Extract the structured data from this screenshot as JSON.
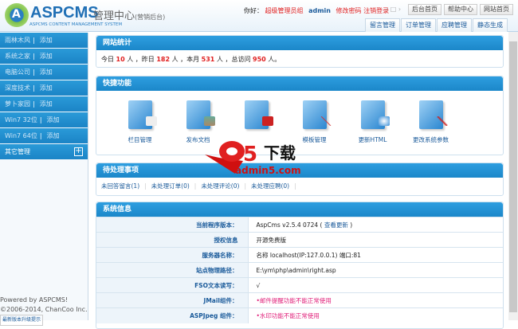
{
  "header": {
    "brand": "ASPCMS",
    "brand_cn": "管理中心",
    "brand_note": "(营销后台)",
    "brand_sub": "ASPCMS CONTENT MANAGEMENT SYSTEM",
    "greeting": "你好：",
    "role": "超级管理员组",
    "user": "admin",
    "change_pwd": "修改密码",
    "logout": "注销登录",
    "arrows": "‹ □ ›",
    "buttons": [
      "后台首页",
      "帮助中心",
      "网站首页"
    ],
    "tabs": [
      "留言管理",
      "订单管理",
      "应聘管理",
      "静态生成"
    ]
  },
  "sidebar": {
    "items": [
      {
        "label": "雨林木风",
        "add": "添加"
      },
      {
        "label": "系统之家",
        "add": "添加"
      },
      {
        "label": "电脑公司",
        "add": "添加"
      },
      {
        "label": "深度技术",
        "add": "添加"
      },
      {
        "label": "萝卜家园",
        "add": "添加"
      },
      {
        "label": "Win7 32位",
        "add": "添加"
      },
      {
        "label": "Win7 64位",
        "add": "添加"
      }
    ],
    "other": "其它管理",
    "other_icon": "plus-icon",
    "footer": [
      "Powered by ASPCMS!",
      "©2006-2014, ChanCoo Inc."
    ],
    "footer_link": "最新版本升级提示"
  },
  "stats": {
    "title": "网站统计",
    "today_label": "今日",
    "today": "10",
    "yesterday_label": "，昨日",
    "yesterday": "182",
    "month_label": "，本月",
    "month": "531",
    "total_label": "，总访问",
    "total": "950",
    "unit": "人",
    "end": "。"
  },
  "quick": {
    "title": "快捷功能",
    "items": [
      {
        "label": "栏目管理"
      },
      {
        "label": "发布文档"
      },
      {
        "label": ""
      },
      {
        "label": "模板管理"
      },
      {
        "label": "更新HTML"
      },
      {
        "label": "更改系统参数"
      }
    ]
  },
  "pending": {
    "title": "待处理事项",
    "items": [
      "未回答留言(1)",
      "未处理订单(0)",
      "未处理评论(0)",
      "未处理应聘(0)"
    ]
  },
  "sysinfo": {
    "title": "系统信息",
    "rows": [
      {
        "k": "当前程序版本：",
        "v": "AspCms v2.5.4 0724",
        "link": "查看更新"
      },
      {
        "k": "授权信息",
        "v": "开源免费版"
      },
      {
        "k": "服务器名称：",
        "v": "名称 localhost(IP:127.0.0.1) 端口:81"
      },
      {
        "k": "站点物理路径：",
        "v": "E:\\ym\\php\\admin\\right.asp"
      },
      {
        "k": "FSO文本读写：",
        "v": "√"
      },
      {
        "k": "JMail组件：",
        "v": "•邮件提醒功能不能正常使用",
        "warn": true
      },
      {
        "k": "ASPJpeg 组件：",
        "v": "•水印功能不能正常使用",
        "warn": true
      }
    ]
  },
  "watermark": {
    "text": "a5下载",
    "url": "admin5.com"
  },
  "colors": {
    "accent": "#1b87c9",
    "warn": "#e0207a",
    "red": "#e02020"
  }
}
